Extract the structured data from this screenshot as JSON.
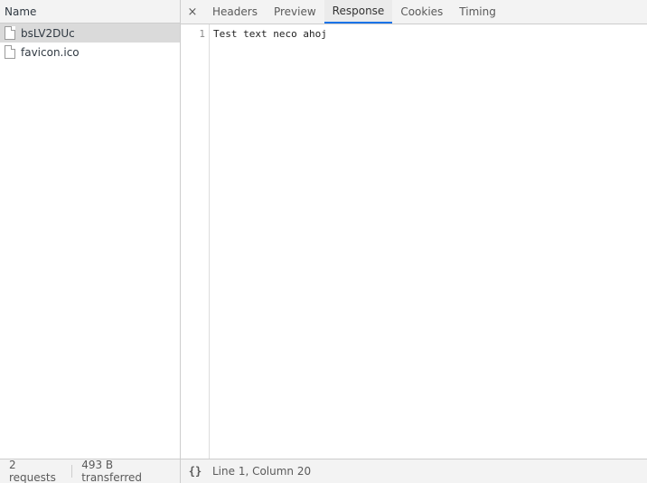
{
  "request_list": {
    "header": "Name",
    "requests": [
      {
        "name": "bsLV2DUc",
        "selected": true
      },
      {
        "name": "favicon.ico",
        "selected": false
      }
    ]
  },
  "detail": {
    "close_label": "×",
    "tabs": [
      {
        "label": "Headers",
        "active": false
      },
      {
        "label": "Preview",
        "active": false
      },
      {
        "label": "Response",
        "active": true
      },
      {
        "label": "Cookies",
        "active": false
      },
      {
        "label": "Timing",
        "active": false
      }
    ],
    "response": {
      "line_number": "1",
      "content": "Test text neco ahoj"
    }
  },
  "status": {
    "requests": "2 requests",
    "transferred": "493 B transferred",
    "pretty_print_label": "{}",
    "cursor_position": "Line 1, Column 20"
  },
  "colors": {
    "active_tab_underline": "#1a73e8",
    "selected_row": "#dadada",
    "panel_background": "#f3f3f3"
  }
}
